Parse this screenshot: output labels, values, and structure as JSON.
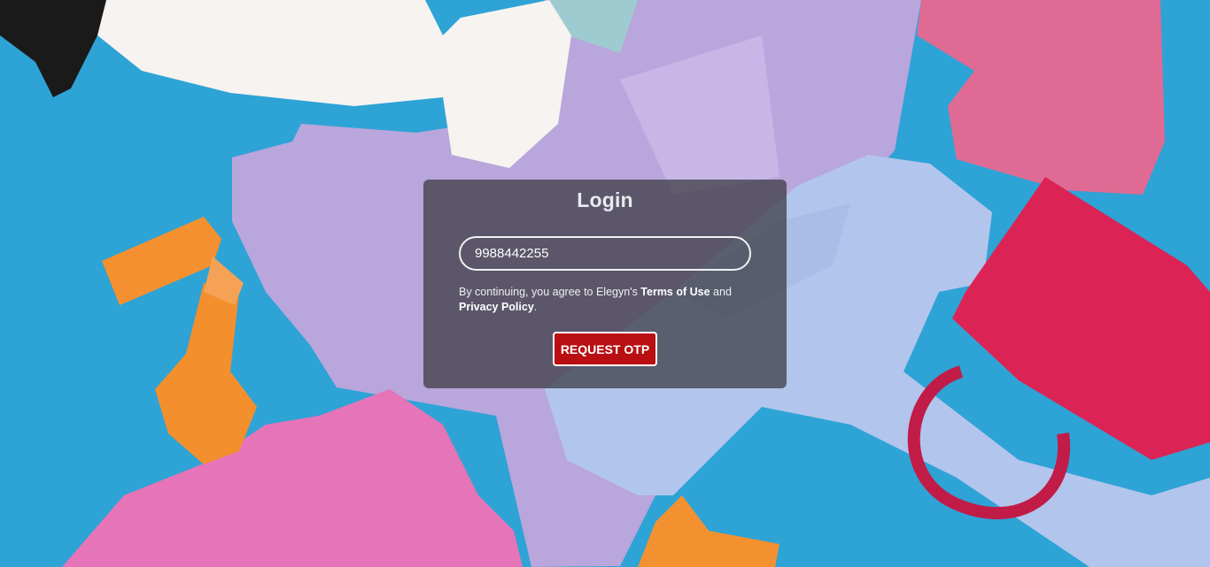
{
  "login": {
    "title": "Login",
    "phone_value": "9988442255",
    "consent_prefix": "By continuing, you agree to Elegyn's ",
    "terms_label": "Terms of Use",
    "consent_and": " and ",
    "privacy_label": "Privacy Policy",
    "consent_suffix": ".",
    "request_otp_label": "REQUEST OTP"
  },
  "colors": {
    "background": "#2ea3d6",
    "button": "#b90f12",
    "card": "rgba(55,55,62,0.72)"
  }
}
